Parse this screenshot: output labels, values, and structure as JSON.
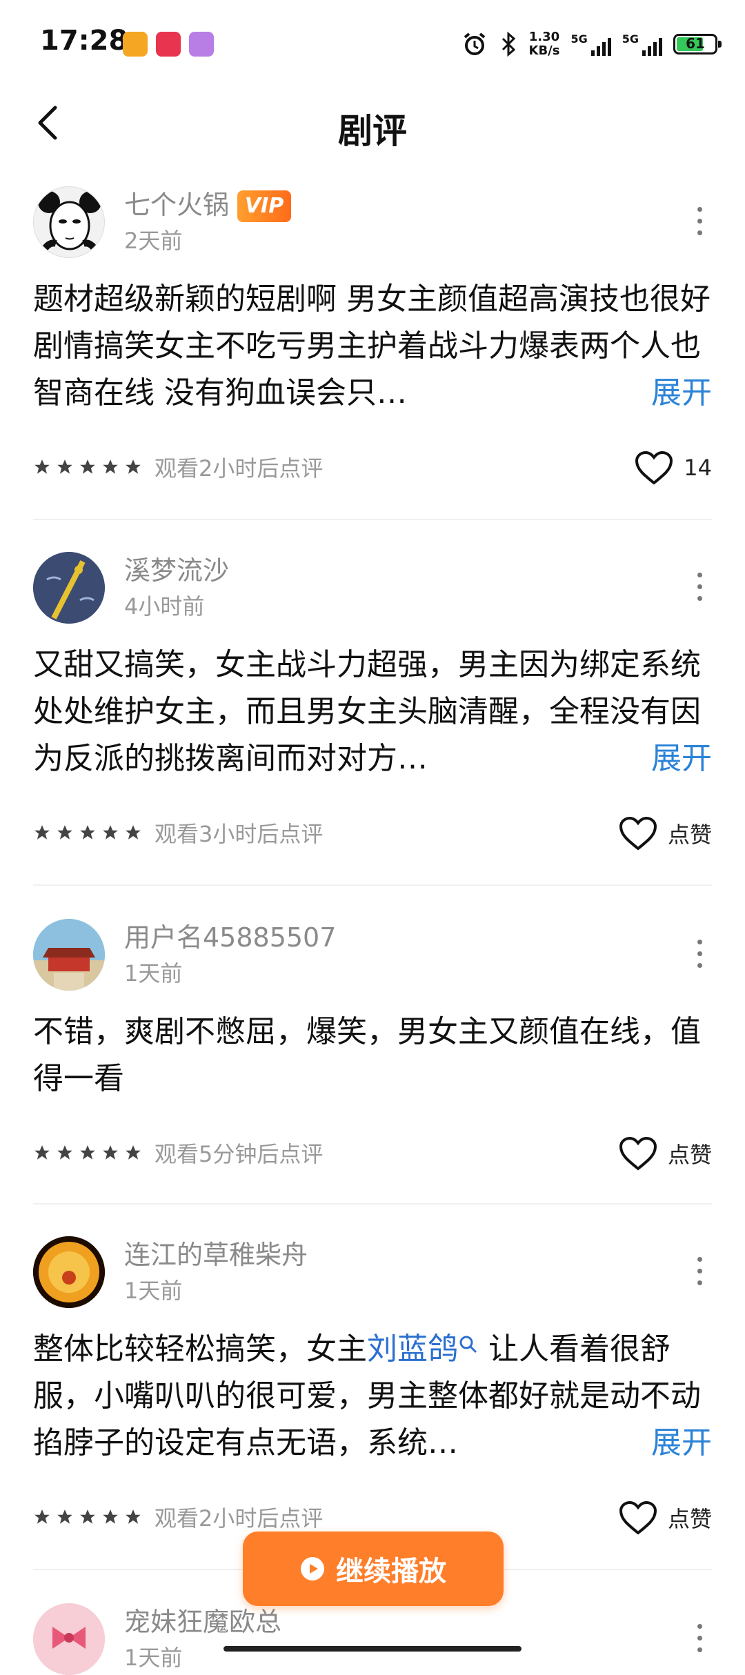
{
  "status_bar": {
    "time": "17:28",
    "speed_top": "1.30",
    "speed_bottom": "KB/s",
    "net1": "5G",
    "net2": "5G",
    "battery": "61"
  },
  "header": {
    "title": "剧评"
  },
  "reviews": [
    {
      "username": "七个火锅",
      "vip_label": "VIP",
      "time": "2天前",
      "text": "题材超级新颖的短剧啊 男女主颜值超高演技也很好 剧情搞笑女主不吃亏男主护着战斗力爆表两个人也智商在线 没有狗血误会只…",
      "expand": "展开",
      "watch": "观看2小时后点评",
      "likes": "14"
    },
    {
      "username": "溪梦流沙",
      "time": "4小时前",
      "text": "又甜又搞笑，女主战斗力超强，男主因为绑定系统处处维护女主，而且男女主头脑清醒，全程没有因为反派的挑拨离间而对对方…",
      "expand": "展开",
      "watch": "观看3小时后点评",
      "likes": "点赞"
    },
    {
      "username": "用户名45885507",
      "time": "1天前",
      "text": "不错，爽剧不憋屈，爆笑，男女主又颜值在线，值得一看",
      "watch": "观看5分钟后点评",
      "likes": "点赞"
    },
    {
      "username": "连江的草稚柴舟",
      "time": "1天前",
      "text_before": "整体比较轻松搞笑，女主",
      "text_link": "刘蓝鸽",
      "text_after": " 让人看着很舒服，小嘴叭叭的很可爱，男主整体都好就是动不动掐脖子的设定有点无语，系统…",
      "expand": "展开",
      "watch": "观看2小时后点评",
      "likes": "点赞"
    },
    {
      "username": "宠妹狂魔欧总",
      "time": "1天前"
    }
  ],
  "continue_button": {
    "label": "继续播放"
  },
  "colors": {
    "accent": "#ff7e2a",
    "link": "#2b83d8",
    "vip": "#ff8a25"
  }
}
